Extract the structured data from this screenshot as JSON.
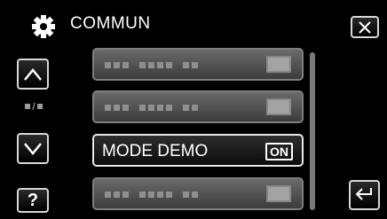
{
  "header": {
    "title": "COMMUN",
    "icon": "gear-icon"
  },
  "nav": {
    "up_icon": "chevron-up-icon",
    "down_icon": "chevron-down-icon",
    "page_separator": "/",
    "help_label": "?",
    "close_icon": "close-icon",
    "back_icon": "return-icon"
  },
  "menu": {
    "items": [
      {
        "label": "",
        "value": ""
      },
      {
        "label": "",
        "value": ""
      },
      {
        "label": "MODE DEMO",
        "value": "ON"
      },
      {
        "label": "",
        "value": ""
      }
    ],
    "selected_index": 2
  },
  "colors": {
    "background": "#000000",
    "item_fill": "#555555",
    "selected_border": "#e8e8e8"
  }
}
